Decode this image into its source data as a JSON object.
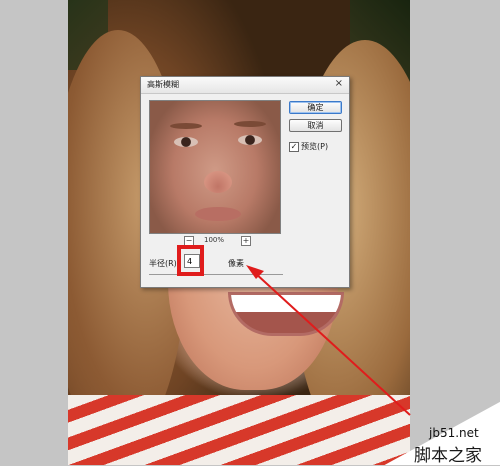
{
  "dialog": {
    "title": "高斯模糊",
    "close_glyph": "×",
    "ok_label": "确定",
    "cancel_label": "取消",
    "preview_checkbox": {
      "label": "预览(P)",
      "checked": "✓"
    },
    "zoom": {
      "minus": "−",
      "level": "100%",
      "plus": "+"
    },
    "radius": {
      "label": "半径(R):",
      "value": "4",
      "unit": "像素"
    }
  },
  "annotation": {
    "highlight_color": "#e01c1c",
    "arrow_color": "#e01c1c"
  },
  "watermark": {
    "line1": "jb51.net",
    "line2": "脚本之家"
  }
}
